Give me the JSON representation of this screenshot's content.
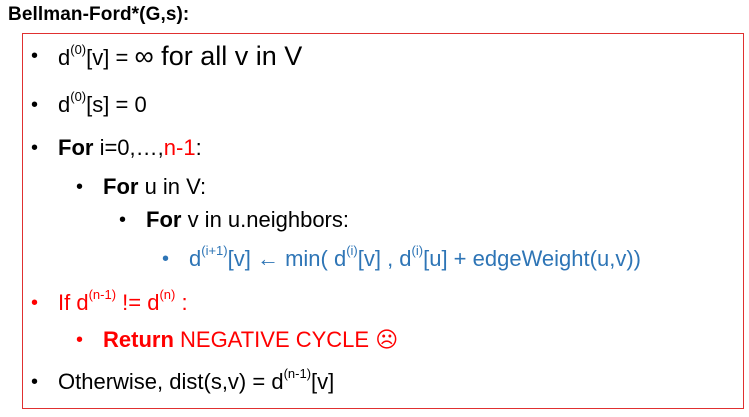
{
  "title": "Bellman-Ford*(G,s):",
  "bullet": "•",
  "lines": {
    "l1": {
      "a": "d",
      "sup": "(0)",
      "b": "[v] = ",
      "c": "∞ for all v in V"
    },
    "l2": {
      "a": "d",
      "sup": "(0)",
      "b": "[s] = 0"
    },
    "l3": {
      "kw": "For",
      "a": " i=0,…,",
      "red": "n-1",
      "b": ":"
    },
    "l4": {
      "kw": "For",
      "a": " u in V:"
    },
    "l5": {
      "kw": "For",
      "a": " v in u.neighbors:"
    },
    "l6": {
      "a": "d",
      "sup1": "(i+1)",
      "b": "[v] ← min( d",
      "sup2": "(i)",
      "c": "[v] , d",
      "sup3": "(i)",
      "d": "[u] + edgeWeight(u,v))"
    },
    "l7": {
      "a": "If d",
      "sup1": "(n-1)",
      "b": " != d",
      "sup2": "(n)",
      "c": " :"
    },
    "l8": {
      "kw": "Return",
      "a": " NEGATIVE CYCLE ",
      "face": "☹"
    },
    "l9": {
      "a": "Otherwise, dist(s,v) = d",
      "sup": "(n-1)",
      "b": "[v]"
    }
  },
  "colors": {
    "red": "#ff0000",
    "blue": "#2e75b6",
    "border": "#e03030"
  }
}
